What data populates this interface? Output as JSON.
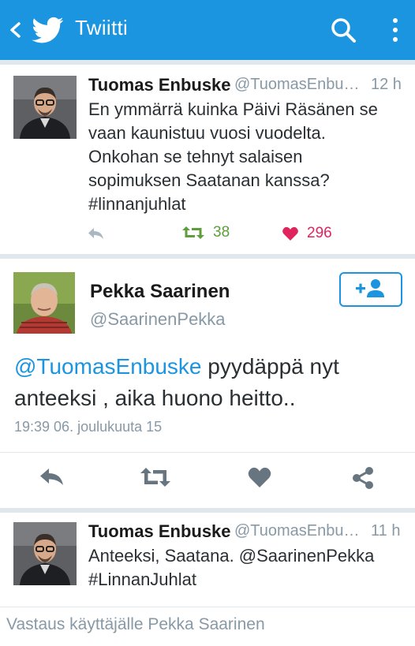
{
  "header": {
    "title": "Twiitti",
    "back_icon": "chevron-left-icon",
    "logo_icon": "twitter-bird-icon",
    "search_icon": "search-icon",
    "menu_icon": "more-vertical-icon",
    "color": "#1b95e0"
  },
  "tweets": [
    {
      "name": "Tuomas Enbuske",
      "handle": "@TuomasEnbus...",
      "time": "12 h",
      "lines": [
        "En ymmärrä kuinka Päivi Räsänen se",
        "vaan kaunistuu vuosi vuodelta.",
        "Onkohan se tehnyt salaisen",
        "sopimuksen Saatanan kanssa?",
        "#linnanjuhlat"
      ],
      "retweets": "38",
      "likes": "296"
    },
    {
      "name": "Tuomas Enbuske",
      "handle": "@TuomasEnbus...",
      "time": "11 h",
      "lines": [
        "Anteeksi, Saatana. @SaarinenPekka",
        "#LinnanJuhlat"
      ]
    }
  ],
  "focused_tweet": {
    "name": "Pekka Saarinen",
    "handle": "@SaarinenPekka",
    "mention": "@TuomasEnbuske",
    "text_after_mention": " pyydäppä nyt",
    "text_line2": "anteeksi , aika huono heitto..",
    "date": "19:39 06. joulukuuta 15",
    "follow_icon": "add-user-icon"
  },
  "reply": {
    "placeholder": "Vastaus käyttäjälle Pekka Saarinen"
  },
  "colors": {
    "accent": "#1b95e0",
    "retweet": "#5c9f3a",
    "like": "#e0245e",
    "muted": "#8899a6",
    "action_icon": "#66757f"
  }
}
